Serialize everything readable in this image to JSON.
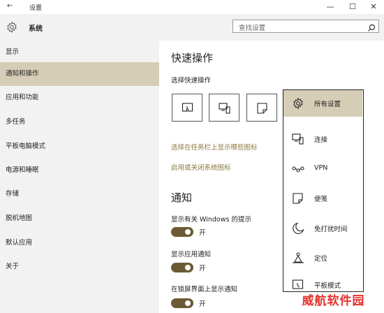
{
  "window": {
    "title": "设置",
    "back_glyph": "←",
    "min_glyph": "—",
    "max_glyph": "☐",
    "close_glyph": "✕"
  },
  "header": {
    "section_title": "系统",
    "search_placeholder": "查找设置",
    "icon": "gear-icon"
  },
  "sidebar": {
    "items": [
      {
        "label": "显示",
        "active": false
      },
      {
        "label": "通知和操作",
        "active": true
      },
      {
        "label": "应用和功能",
        "active": false
      },
      {
        "label": "多任务",
        "active": false
      },
      {
        "label": "平板电脑模式",
        "active": false
      },
      {
        "label": "电源和睡眠",
        "active": false
      },
      {
        "label": "存储",
        "active": false
      },
      {
        "label": "脱机地图",
        "active": false
      },
      {
        "label": "默认应用",
        "active": false
      },
      {
        "label": "关于",
        "active": false
      }
    ]
  },
  "main": {
    "quick_actions_title": "快速操作",
    "quick_actions_subtitle": "选择快速操作",
    "taskbar_icons_link": "选择在任务栏上显示哪些图标",
    "system_icons_link": "启用或关闭系统图标",
    "notifications_title": "通知",
    "settings": [
      {
        "label": "显示有关 Windows 的提示",
        "state": "开"
      },
      {
        "label": "显示应用通知",
        "state": "开"
      },
      {
        "label": "在锁屏界面上显示通知",
        "state": "开"
      }
    ]
  },
  "flyout": {
    "items": [
      {
        "label": "所有设置",
        "icon": "gear-icon",
        "active": true
      },
      {
        "label": "连接",
        "icon": "connect-icon",
        "active": false
      },
      {
        "label": "VPN",
        "icon": "vpn-icon",
        "active": false
      },
      {
        "label": "便笺",
        "icon": "note-icon",
        "active": false
      },
      {
        "label": "免打扰时间",
        "icon": "moon-icon",
        "active": false
      },
      {
        "label": "定位",
        "icon": "location-icon",
        "active": false
      },
      {
        "label": "平板模式",
        "icon": "tablet-mode-icon",
        "active": false
      }
    ]
  },
  "watermark": "威航软件园",
  "colors": {
    "accent": "#d6cdb7",
    "toggle_on": "#6b5b34",
    "link": "#8c7740",
    "watermark": "#e5322d"
  }
}
